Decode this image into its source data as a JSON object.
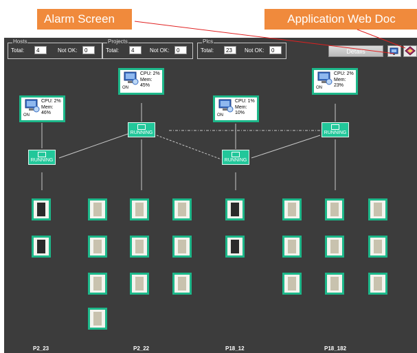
{
  "callouts": {
    "alarm_screen": "Alarm Screen",
    "application_web_doc": "Application  Web Doc",
    "accent_color": "#f08a3c",
    "arrow_color": "#e02020"
  },
  "summary": {
    "hosts": {
      "legend": "Hosts",
      "total_label": "Total:",
      "total_value": "4",
      "notok_label": "Not OK:",
      "notok_value": "0"
    },
    "projects": {
      "legend": "Projects",
      "total_label": "Total:",
      "total_value": "4",
      "notok_label": "Not OK:",
      "notok_value": "0"
    },
    "plcs": {
      "legend": "Plcs",
      "total_label": "Total:",
      "total_value": "23",
      "notok_label": "Not OK:",
      "notok_value": "0"
    }
  },
  "toolbar": {
    "details_label": "Details",
    "alarm_button_icon": "alarm-screen-icon",
    "web_doc_button_icon": "web-doc-icon"
  },
  "hosts": [
    {
      "cpu": "CPU: 2%",
      "mem": "Mem: 46%",
      "state": "ON"
    },
    {
      "cpu": "CPU: 2%",
      "mem": "Mem: 45%",
      "state": "ON"
    },
    {
      "cpu": "CPU: 1%",
      "mem": "Mem: 10%",
      "state": "ON"
    },
    {
      "cpu": "CPU: 2%",
      "mem": "Mem: 23%",
      "state": "ON"
    }
  ],
  "projects": [
    {
      "status": "RUNNING"
    },
    {
      "status": "RUNNING"
    },
    {
      "status": "RUNNING"
    },
    {
      "status": "RUNNING"
    }
  ],
  "columns": [
    {
      "label": "P2_23"
    },
    {
      "label": "P2_22"
    },
    {
      "label": "P18_12"
    },
    {
      "label": "P18_182"
    }
  ],
  "colors": {
    "panel_bg": "#3c3c3c",
    "node_accent": "#1db88a",
    "project_fill": "#22c79a"
  }
}
